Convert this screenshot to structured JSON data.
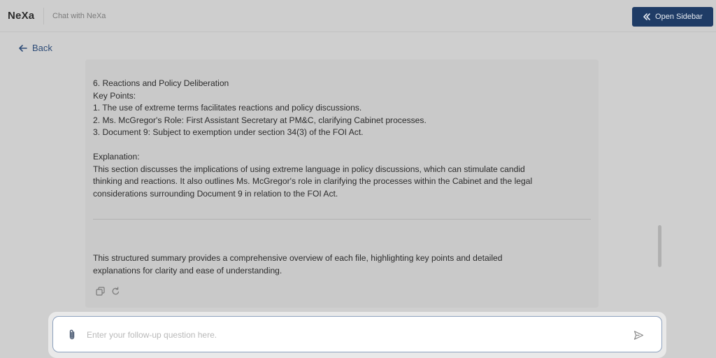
{
  "header": {
    "brand": "NeXa",
    "subtitle": "Chat with NeXa",
    "open_sidebar_label": "Open Sidebar"
  },
  "nav": {
    "back_label": "Back"
  },
  "message": {
    "lines": [
      "6. Reactions and Policy Deliberation",
      "Key Points:",
      "1. The use of extreme terms facilitates reactions and policy discussions.",
      "2. Ms. McGregor's Role: First Assistant Secretary at PM&C, clarifying Cabinet processes.",
      "3. Document 9: Subject to exemption under section 34(3) of the FOI Act."
    ],
    "explanation_heading": "Explanation:",
    "explanation_lines": [
      "This section discusses the implications of using extreme language in policy discussions, which can stimulate candid",
      "thinking and reactions. It also outlines Ms. McGregor's role in clarifying the processes within the Cabinet and the legal",
      "considerations surrounding Document 9 in relation to the FOI Act."
    ],
    "summary_lines": [
      "This structured summary provides a comprehensive overview of each file, highlighting key points and detailed",
      "explanations for clarity and ease of understanding."
    ]
  },
  "composer": {
    "placeholder": "Enter your follow-up question here.",
    "value": ""
  },
  "colors": {
    "primary": "#1f3c66",
    "overlay_bg": "#cfcfcf",
    "link": "#2e4c77"
  }
}
